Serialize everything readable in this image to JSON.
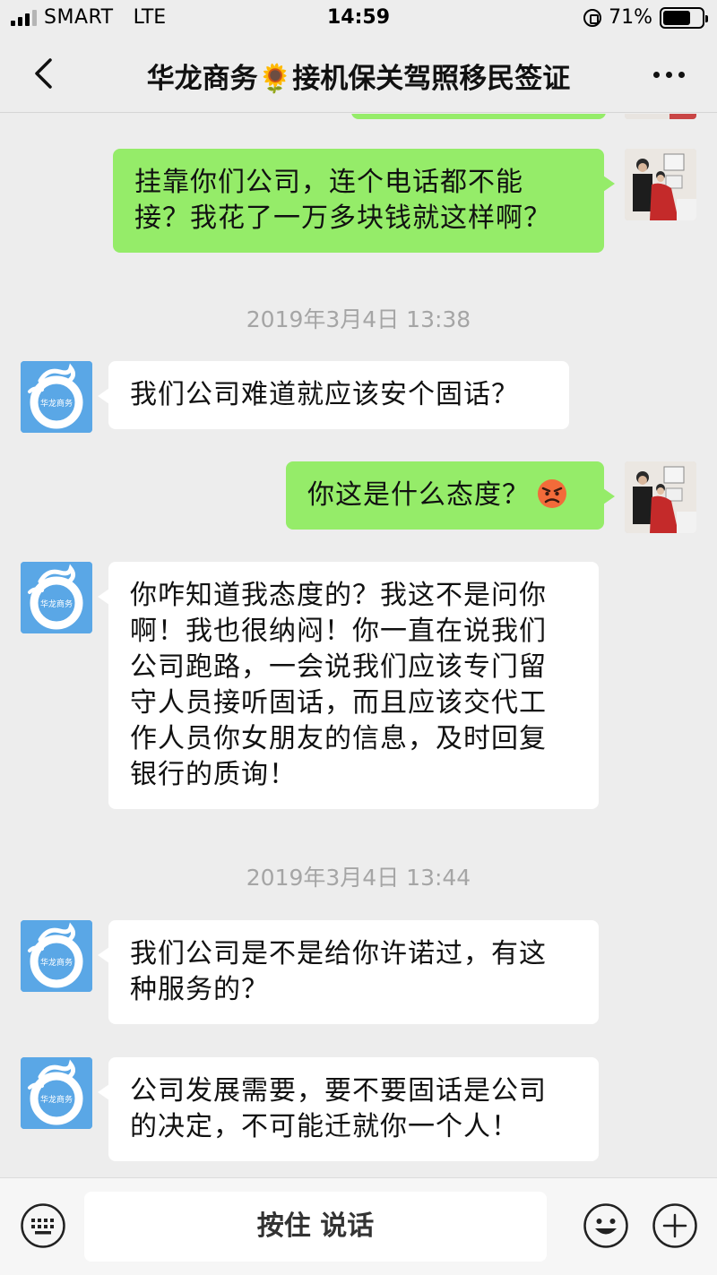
{
  "status_bar": {
    "carrier": "SMART",
    "network": "LTE",
    "time": "14:59",
    "battery": "71%",
    "battery_level": 0.71
  },
  "nav": {
    "title": "华龙商务🌻接机保关驾照移民签证"
  },
  "messages": [
    {
      "sender": "me",
      "text_lines": [
        "挂靠你们公司，连个电话都不能",
        "接？我花了一万多块钱就这样啊？"
      ]
    },
    {
      "timestamp": "2019年3月4日 13:38"
    },
    {
      "sender": "company",
      "text_lines": [
        "我们公司难道就应该安个固话？"
      ]
    },
    {
      "sender": "me",
      "text_lines": [
        "你这是什么态度？"
      ],
      "emoji": "angry-face"
    },
    {
      "sender": "company",
      "text_lines": [
        "你咋知道我态度的？我这不是问你",
        "啊！我也很纳闷！你一直在说我们",
        "公司跑路，一会说我们应该专门留",
        "守人员接听固话，而且应该交代工",
        "作人员你女朋友的信息，及时回复",
        "银行的质询！"
      ]
    },
    {
      "timestamp": "2019年3月4日 13:44"
    },
    {
      "sender": "company",
      "text_lines": [
        "我们公司是不是给你许诺过，有这",
        "种服务的？"
      ]
    },
    {
      "sender": "company",
      "text_lines": [
        "公司发展需要，要不要固话是公司",
        "的决定，不可能迁就你一个人！"
      ]
    }
  ],
  "input_bar": {
    "hold_to_talk": "按住 说话"
  },
  "colors": {
    "my_bubble": "#95ec69",
    "their_bubble": "#ffffff",
    "background": "#ededed",
    "company_avatar": "#5aa7e6"
  }
}
